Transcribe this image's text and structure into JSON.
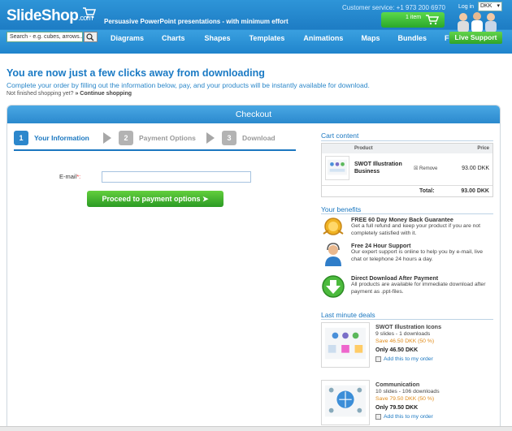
{
  "header": {
    "logo_main": "SlideShop",
    "logo_suffix": ".com",
    "tagline": "Persuasive PowerPoint presentations - with minimum effort",
    "service": "Customer service: +1 973 200 6970",
    "login": "Log in",
    "currency": "DKK",
    "cart_label": "1 item",
    "search_placeholder": "Search - e.g. cubes, arrows...",
    "nav": [
      "Diagrams",
      "Charts",
      "Shapes",
      "Templates",
      "Animations",
      "Maps",
      "Bundles",
      "Free"
    ],
    "live_support": "Live Support"
  },
  "intro": {
    "headline": "You are now just a few clicks away from downloading",
    "sub": "Complete your order by filling out the information below, pay, and your products will be instantly available for download.",
    "not_finished": "Not finished shopping yet?",
    "continue": "» Continue shopping"
  },
  "checkout": {
    "title": "Checkout",
    "steps": [
      {
        "num": "1",
        "label": "Your Information"
      },
      {
        "num": "2",
        "label": "Payment Options"
      },
      {
        "num": "3",
        "label": "Download"
      }
    ],
    "email_label": "E-mail",
    "email_required": "*:",
    "email_value": "",
    "proceed": "Proceed to payment options  ➤"
  },
  "cart": {
    "title": "Cart content",
    "col_product": "Product",
    "col_price": "Price",
    "item_name": "SWOT Illustration Business",
    "remove": "Remove",
    "item_price": "93.00 DKK",
    "total_label": "Total:",
    "total_value": "93.00 DKK"
  },
  "benefits": {
    "title": "Your benefits",
    "items": [
      {
        "title": "FREE 60 Day Money Back Guarantee",
        "text": "Get a full refund and keep your product if you are not completely satisfied with it.",
        "icon": "medal-icon"
      },
      {
        "title": "Free 24 Hour Support",
        "text": "Our expert support is online to help you by e-mail, live chat or telephone 24 hours a day.",
        "icon": "headset-icon"
      },
      {
        "title": "Direct Download After Payment",
        "text": "All products are available for immediate download after payment as .ppt-files.",
        "icon": "download-arrow-icon"
      }
    ]
  },
  "deals": {
    "title": "Last minute deals",
    "items": [
      {
        "title": "SWOT Illustration Icons",
        "meta": "9 slides - 1 downloads",
        "save": "Save 46.50 DKK (50 %)",
        "only": "Only 46.50 DKK",
        "add": "Add this to my order"
      },
      {
        "title": "Communication",
        "meta": "10 slides - 106 downloads",
        "save": "Save 79.50 DKK (50 %)",
        "only": "Only 79.50 DKK",
        "add": "Add this to my order"
      }
    ]
  },
  "colors": {
    "brand_blue": "#1d7cc4",
    "accent_green": "#2fa32a",
    "save_orange": "#e08b1a"
  }
}
